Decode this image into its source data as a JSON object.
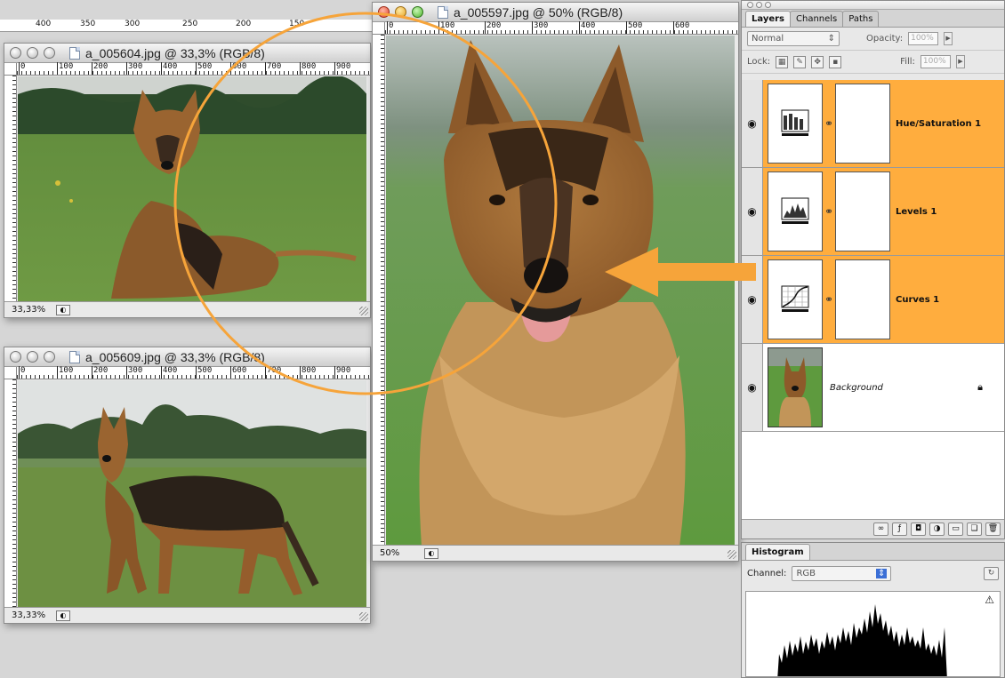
{
  "windows": {
    "doc_main": {
      "title": "a_005597.jpg @ 50% (RGB/8)",
      "zoom": "50%",
      "ruler": [
        "0",
        "100",
        "200",
        "300",
        "400",
        "500",
        "600"
      ]
    },
    "doc_top": {
      "title": "a_005604.jpg @ 33,3% (RGB/8)",
      "zoom": "33,33%",
      "ruler": [
        "0",
        "100",
        "200",
        "300",
        "400",
        "500",
        "600",
        "700",
        "800",
        "900"
      ]
    },
    "doc_bottom": {
      "title": "a_005609.jpg @ 33,3% (RGB/8)",
      "zoom": "33,33%",
      "ruler": [
        "0",
        "100",
        "200",
        "300",
        "400",
        "500",
        "600",
        "700",
        "800",
        "900"
      ]
    }
  },
  "background_ruler": [
    "400",
    "350",
    "300",
    "250",
    "200",
    "150"
  ],
  "layers_panel": {
    "tabs": [
      "Layers",
      "Channels",
      "Paths"
    ],
    "blend_mode": "Normal",
    "opacity_label": "Opacity:",
    "opacity_value": "100%",
    "lock_label": "Lock:",
    "fill_label": "Fill:",
    "fill_value": "100%",
    "layers": [
      {
        "name": "Hue/Saturation 1",
        "type": "adjustment",
        "icon": "hue-saturation-icon"
      },
      {
        "name": "Levels 1",
        "type": "adjustment",
        "icon": "levels-icon"
      },
      {
        "name": "Curves 1",
        "type": "adjustment",
        "icon": "curves-icon"
      },
      {
        "name": "Background",
        "type": "image",
        "locked": true
      }
    ]
  },
  "histogram_panel": {
    "tab": "Histogram",
    "channel_label": "Channel:",
    "channel_value": "RGB"
  },
  "colors": {
    "highlight": "#ffad3e",
    "annotation": "#f6a43a"
  }
}
